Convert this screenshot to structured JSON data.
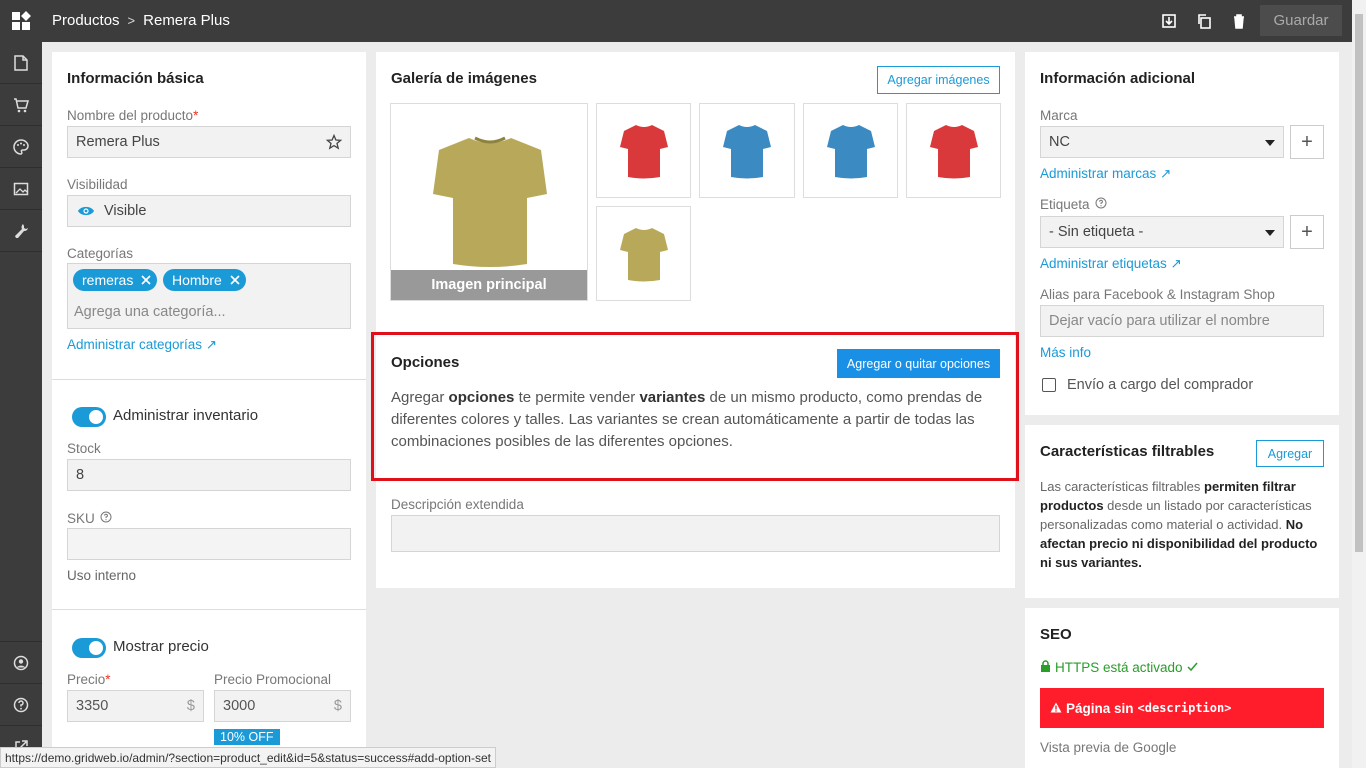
{
  "header": {
    "crumb_root": "Productos",
    "crumb_sep": ">",
    "crumb_current": "Remera Plus",
    "save_label": "Guardar"
  },
  "basic": {
    "title": "Información básica",
    "name_label": "Nombre del producto",
    "name_required": "*",
    "name_value": "Remera Plus",
    "visibility_label": "Visibilidad",
    "visibility_value": "Visible",
    "categories_label": "Categorías",
    "chips": [
      "remeras",
      "Hombre"
    ],
    "category_placeholder": "Agrega una categoría...",
    "manage_categories": "Administrar categorías ↗"
  },
  "inventory": {
    "toggle_label": "Administrar inventario",
    "stock_label": "Stock",
    "stock_value": "8",
    "sku_label": "SKU",
    "sku_value": "",
    "internal_use": "Uso interno"
  },
  "price": {
    "toggle_label": "Mostrar precio",
    "price_label": "Precio",
    "price_required": "*",
    "price_value": "3350",
    "promo_label": "Precio Promocional",
    "promo_value": "3000",
    "currency": "$",
    "discount_badge": "10% OFF"
  },
  "gallery": {
    "title": "Galería de imágenes",
    "add_button": "Agregar imágenes",
    "main_caption": "Imagen principal",
    "images": [
      "olive",
      "red",
      "blue",
      "blue",
      "red",
      "olive"
    ]
  },
  "options": {
    "title": "Opciones",
    "button": "Agregar o quitar opciones",
    "text_1": "Agregar ",
    "text_b1": "opciones",
    "text_2": " te permite vender ",
    "text_b2": "variantes",
    "text_3": " de un mismo producto, como prendas de diferentes colores y talles. Las variantes se crean automáticamente a partir de todas las combinaciones posibles de las diferentes opciones."
  },
  "description": {
    "label": "Descripción extendida"
  },
  "additional": {
    "title": "Información adicional",
    "brand_label": "Marca",
    "brand_value": "NC",
    "manage_brands": "Administrar marcas ↗",
    "tag_label": "Etiqueta",
    "tag_value": "- Sin etiqueta -",
    "manage_tags": "Administrar etiquetas ↗",
    "alias_label": "Alias para Facebook & Instagram Shop",
    "alias_placeholder": "Dejar vacío para utilizar el nombre",
    "more_info": "Más info",
    "shipping_label": "Envío a cargo del comprador"
  },
  "filters": {
    "title": "Características filtrables",
    "add_button": "Agregar",
    "t1": "Las características filtrables ",
    "b1": "permiten filtrar productos",
    "t2": " desde un listado por características personalizadas como material o actividad. ",
    "b2": "No afectan precio ni disponibilidad del producto ni sus variantes."
  },
  "seo": {
    "title": "SEO",
    "https_text": "HTTPS está activado",
    "alert_text": "Página sin ",
    "alert_code": "<description>",
    "google_preview": "Vista previa de Google"
  },
  "statusbar": {
    "url": "https://demo.gridweb.io/admin/?section=product_edit&id=5&status=success#add-option-set"
  },
  "colors": {
    "accent": "#1a9ad6",
    "highlight": "#e0101a",
    "alert": "#ff1c2b",
    "success": "#2a9d2a"
  }
}
